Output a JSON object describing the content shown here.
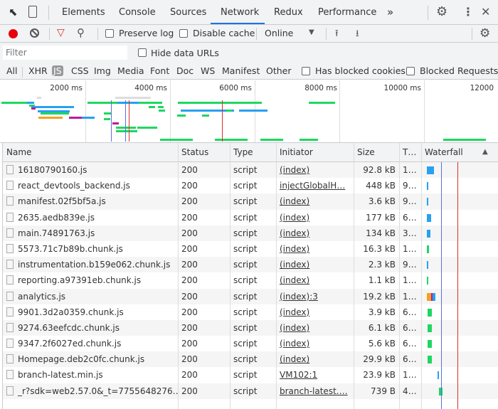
{
  "tabs": {
    "items": [
      "Elements",
      "Console",
      "Sources",
      "Network",
      "Redux",
      "Performance"
    ],
    "active": "Network",
    "more": "»"
  },
  "toolbar": {
    "preserve_log": "Preserve log",
    "disable_cache": "Disable cache",
    "throttle": "Online"
  },
  "filter": {
    "placeholder": "Filter",
    "hide_data_urls": "Hide data URLs",
    "types": [
      "All",
      "XHR",
      "JS",
      "CSS",
      "Img",
      "Media",
      "Font",
      "Doc",
      "WS",
      "Manifest",
      "Other"
    ],
    "active_type": "JS",
    "blocked_cookies": "Has blocked cookies",
    "blocked_requests": "Blocked Requests"
  },
  "overview": {
    "ticks": [
      "2000 ms",
      "4000 ms",
      "6000 ms",
      "8000 ms",
      "10000 ms",
      "12000"
    ]
  },
  "colors": {
    "accent": "#1a73e8",
    "record": "#e8000b",
    "filter_active": "#d93025",
    "load_line": "#d93025",
    "dcl_line": "#5b6fe0"
  },
  "table": {
    "headers": [
      "Name",
      "Status",
      "Type",
      "Initiator",
      "Size",
      "T…",
      "Waterfall"
    ],
    "rows": [
      {
        "name": "16180790160.js",
        "status": "200",
        "type": "script",
        "initiator": "(index)",
        "size": "92.8 kB",
        "time": "1…"
      },
      {
        "name": "react_devtools_backend.js",
        "status": "200",
        "type": "script",
        "initiator": "injectGlobalH…",
        "size": "448 kB",
        "time": "9…"
      },
      {
        "name": "manifest.02f5bf5a.js",
        "status": "200",
        "type": "script",
        "initiator": "(index)",
        "size": "3.6 kB",
        "time": "9…"
      },
      {
        "name": "2635.aedb839e.js",
        "status": "200",
        "type": "script",
        "initiator": "(index)",
        "size": "177 kB",
        "time": "6…"
      },
      {
        "name": "main.74891763.js",
        "status": "200",
        "type": "script",
        "initiator": "(index)",
        "size": "134 kB",
        "time": "3…"
      },
      {
        "name": "5573.71c7b89b.chunk.js",
        "status": "200",
        "type": "script",
        "initiator": "(index)",
        "size": "16.3 kB",
        "time": "1…"
      },
      {
        "name": "instrumentation.b159e062.chunk.js",
        "status": "200",
        "type": "script",
        "initiator": "(index)",
        "size": "2.3 kB",
        "time": "9…"
      },
      {
        "name": "reporting.a97391eb.chunk.js",
        "status": "200",
        "type": "script",
        "initiator": "(index)",
        "size": "1.1 kB",
        "time": "1…"
      },
      {
        "name": "analytics.js",
        "status": "200",
        "type": "script",
        "initiator": "(index):3",
        "size": "19.2 kB",
        "time": "1…"
      },
      {
        "name": "9901.3d2a0359.chunk.js",
        "status": "200",
        "type": "script",
        "initiator": "(index)",
        "size": "3.9 kB",
        "time": "6…"
      },
      {
        "name": "9274.63eefcdc.chunk.js",
        "status": "200",
        "type": "script",
        "initiator": "(index)",
        "size": "6.1 kB",
        "time": "6…"
      },
      {
        "name": "9347.2f6027ed.chunk.js",
        "status": "200",
        "type": "script",
        "initiator": "(index)",
        "size": "5.6 kB",
        "time": "6…"
      },
      {
        "name": "Homepage.deb2c0fc.chunk.js",
        "status": "200",
        "type": "script",
        "initiator": "(index)",
        "size": "29.9 kB",
        "time": "6…"
      },
      {
        "name": "branch-latest.min.js",
        "status": "200",
        "type": "script",
        "initiator": "VM102:1",
        "size": "23.9 kB",
        "time": "1…"
      },
      {
        "name": "_r?sdk=web2.57.0&_t=7755648276…",
        "status": "200",
        "type": "script",
        "initiator": "branch-latest.…",
        "size": "739 B",
        "time": "4…"
      }
    ]
  }
}
